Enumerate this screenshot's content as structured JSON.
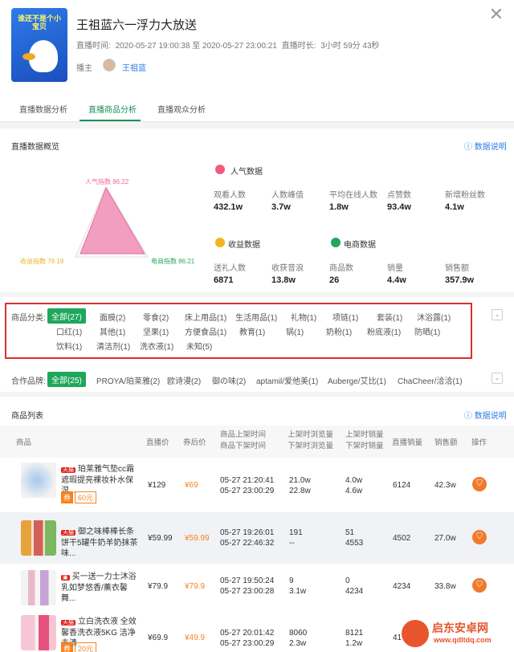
{
  "header": {
    "cover_text": "谁还不是个小宝贝",
    "title": "王祖蓝六一浮力大放送",
    "time_label": "直播时间:",
    "time_value": "2020-05-27 19:00:38 至 2020-05-27 23:00:21",
    "duration_label": "直播时长:",
    "duration_value": "3小时 59分 43秒",
    "anchor_label": "播主",
    "anchor_name": "王祖蓝"
  },
  "tabs": [
    "直播数据分析",
    "直播商品分析",
    "直播观众分析"
  ],
  "active_tab": 1,
  "overview": {
    "title": "直播数据概览",
    "help": "ⓘ 数据说明",
    "radar": {
      "popularity": "人气指数 86.22",
      "revenue": "收益指数 79.19",
      "ecommerce": "电商指数 86.21"
    },
    "popularity_group": {
      "title": "人气数据",
      "metrics": [
        {
          "label": "观看人数",
          "value": "432.1w"
        },
        {
          "label": "人数峰值",
          "value": "3.7w"
        },
        {
          "label": "平均在线人数",
          "value": "1.8w"
        },
        {
          "label": "点赞数",
          "value": "93.4w"
        },
        {
          "label": "新增粉丝数",
          "value": "4.1w"
        }
      ]
    },
    "revenue_group": {
      "title": "收益数据",
      "metrics": [
        {
          "label": "送礼人数",
          "value": "6871"
        },
        {
          "label": "收获音浪",
          "value": "13.8w"
        }
      ]
    },
    "ecommerce_group": {
      "title": "电商数据",
      "metrics": [
        {
          "label": "商品数",
          "value": "26"
        },
        {
          "label": "销量",
          "value": "4.4w"
        },
        {
          "label": "销售额",
          "value": "357.9w"
        }
      ]
    }
  },
  "category_filter": {
    "label": "商品分类:",
    "items": [
      "全部(27)",
      "面膜(2)",
      "零食(2)",
      "床上用品(1)",
      "生活用品(1)",
      "礼物(1)",
      "项链(1)",
      "套装(1)",
      "沐浴露(1)",
      "口红(1)",
      "其他(1)",
      "坚果(1)",
      "方便食品(1)",
      "教育(1)",
      "锅(1)",
      "奶粉(1)",
      "粉底液(1)",
      "防晒(1)",
      "饮料(1)",
      "清洁剂(1)",
      "洗衣液(1)",
      "未知(5)"
    ]
  },
  "brand_filter": {
    "label": "合作品牌:",
    "items": [
      "全部(25)",
      "PROYA/珀莱雅(2)",
      "欧诗漫(2)",
      "御の味(2)",
      "aptamil/爱他美(1)",
      "Auberge/艾比(1)",
      "ChaCheer/洽洽(1)"
    ]
  },
  "product_list": {
    "title": "商品列表",
    "help": "ⓘ 数据说明",
    "columns": [
      "商品",
      "直播价",
      "券后价",
      "商品上架时间",
      "商品下架时间",
      "上架时浏览量",
      "下架时浏览量",
      "上架时销量",
      "下架时销量",
      "直播销量",
      "销售额",
      "操作"
    ],
    "rows": [
      {
        "tag": "天猫",
        "name": "珀莱雅气垫cc霜遮瑕提亮裸妆补水保湿...",
        "coupon_label": "券",
        "coupon_value": "60元",
        "price": "¥129",
        "after": "¥69",
        "up": "05-27 21:20:41",
        "down": "05-27 23:00:29",
        "view_up": "21.0w",
        "view_down": "22.8w",
        "sale_up": "4.0w",
        "sale_down": "4.6w",
        "live_sales": "6124",
        "revenue": "42.3w"
      },
      {
        "tag": "天猫",
        "name": "御之味棒棒长条饼干5罐牛奶羊奶抹茶味...",
        "coupon_label": "",
        "coupon_value": "",
        "price": "¥59.99",
        "after": "¥59.99",
        "up": "05-27 19:26:01",
        "down": "05-27 22:46:32",
        "view_up": "191",
        "view_down": "--",
        "sale_up": "51",
        "sale_down": "4553",
        "live_sales": "4502",
        "revenue": "27.0w"
      },
      {
        "tag": "",
        "name": "买一送一力士沐浴乳如梦悠香/薰衣馨舞...",
        "coupon_label": "",
        "coupon_value": "",
        "price": "¥79.9",
        "after": "¥79.9",
        "up": "05-27 19:50:24",
        "down": "05-27 23:00:28",
        "view_up": "9",
        "view_down": "3.1w",
        "sale_up": "0",
        "sale_down": "4234",
        "live_sales": "4234",
        "revenue": "33.8w"
      },
      {
        "tag": "天猫",
        "name": "立白洗衣液 全效馨香洗衣液5KG 洁净去渍",
        "coupon_label": "券",
        "coupon_value": "20元",
        "price": "¥69.9",
        "after": "¥49.9",
        "up": "05-27 20:01:42",
        "down": "05-27 23:00:29",
        "view_up": "8060",
        "view_down": "2.3w",
        "sale_up": "8121",
        "sale_down": "1.2w",
        "live_sales": "41",
        "revenue": ""
      }
    ]
  },
  "watermark": {
    "line1": "启东安卓网",
    "line2": "www.qdltdq.com"
  },
  "colors": {
    "accent": "#1a8f5a",
    "chip": "#1fa75b",
    "price": "#f7831f",
    "link": "#2b7de0",
    "highlight": "#d9302b"
  }
}
